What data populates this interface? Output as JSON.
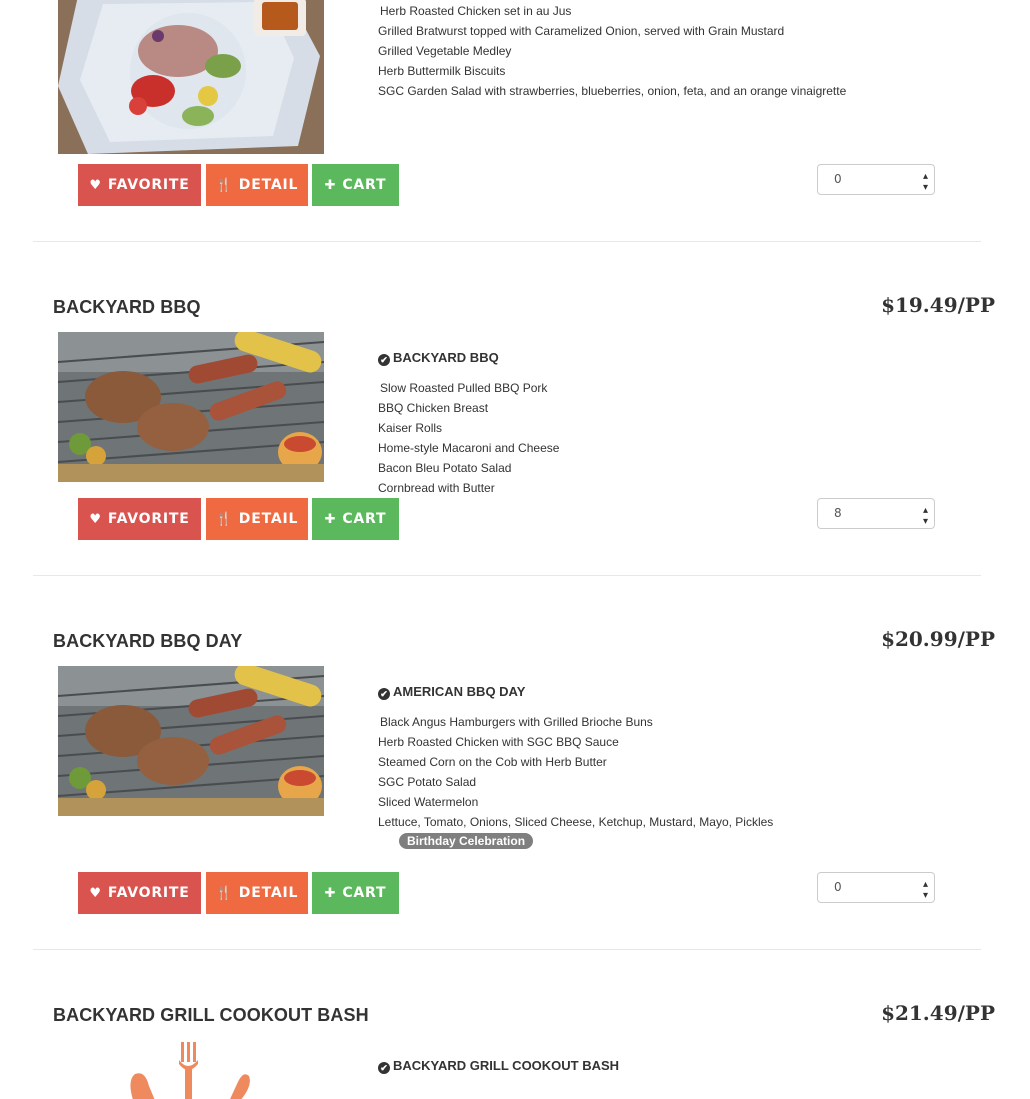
{
  "buttons": {
    "favorite": "FAVORITE",
    "detail": "DETAIL",
    "cart": "CART"
  },
  "items": [
    {
      "title": "",
      "price": "",
      "menu_heading": "",
      "menu_lines": [
        "Herb Roasted Chicken set in au Jus",
        "Grilled Bratwurst topped with Caramelized Onion, served with Grain Mustard",
        "Grilled Vegetable Medley",
        "Herb Buttermilk Biscuits",
        "SGC Garden Salad with strawberries, blueberries, onion, feta, and an orange vinaigrette"
      ],
      "quantity": "0",
      "image": "salad-photo"
    },
    {
      "title": "BACKYARD BBQ",
      "price": "$19.49/PP",
      "menu_heading": "BACKYARD BBQ",
      "menu_lines": [
        "Slow Roasted Pulled BBQ Pork",
        "BBQ Chicken Breast",
        "Kaiser Rolls",
        "Home-style Macaroni and Cheese",
        "Bacon Bleu Potato Salad",
        "Cornbread with Butter"
      ],
      "quantity": "8",
      "image": "grill-photo"
    },
    {
      "title": "BACKYARD BBQ DAY",
      "price": "$20.99/PP",
      "menu_heading": "AMERICAN BBQ DAY",
      "menu_lines": [
        "Black Angus Hamburgers with Grilled Brioche Buns",
        "Herb Roasted Chicken with SGC BBQ Sauce",
        "Steamed Corn on the Cob with Herb Butter",
        "SGC Potato Salad",
        "Sliced Watermelon",
        "Lettuce, Tomato, Onions, Sliced Cheese, Ketchup, Mustard, Mayo, Pickles"
      ],
      "tag": "Birthday Celebration",
      "quantity": "0",
      "image": "grill-photo"
    },
    {
      "title": "BACKYARD GRILL COOKOUT BASH",
      "price": "$21.49/PP",
      "menu_heading": "BACKYARD GRILL COOKOUT BASH",
      "image": "utensils-placeholder-icon"
    }
  ],
  "colors": {
    "favorite": "#d9534f",
    "detail": "#ef6a41",
    "cart": "#5cb85c",
    "placeholder_icon": "#ef8a5f"
  }
}
